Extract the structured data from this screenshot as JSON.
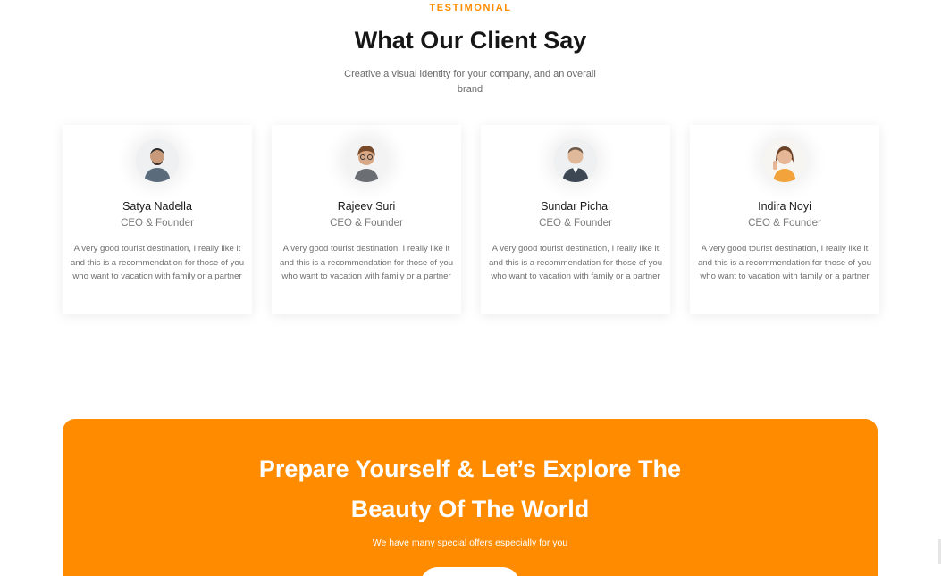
{
  "section": {
    "eyebrow": "TESTIMONIAL",
    "title": "What Our Client Say",
    "subtitle": "Creative a visual identity for your company, and an overall brand"
  },
  "testimonials": [
    {
      "name": "Satya Nadella",
      "role": "CEO & Founder",
      "quote": "A very good tourist destination, I really like it and this is a recommendation for those of you who want to vacation with family or a partner",
      "avatar_icon": "person-avatar-icon"
    },
    {
      "name": "Rajeev Suri",
      "role": "CEO & Founder",
      "quote": "A very good tourist destination, I really like it and this is a recommendation for those of you who want to vacation with family or a partner",
      "avatar_icon": "person-avatar-icon"
    },
    {
      "name": "Sundar Pichai",
      "role": "CEO & Founder",
      "quote": "A very good tourist destination, I really like it and this is a recommendation for those of you who want to vacation with family or a partner",
      "avatar_icon": "person-avatar-icon"
    },
    {
      "name": "Indira Noyi",
      "role": "CEO & Founder",
      "quote": "A very good tourist destination, I really like it and this is a recommendation for those of you who want to vacation with family or a partner",
      "avatar_icon": "person-avatar-icon"
    }
  ],
  "banner": {
    "title_line1": "Prepare Yourself & Let’s Explore The",
    "title_line2": "Beauty Of The World",
    "subtitle": "We have many special offers especially for you"
  },
  "colors": {
    "accent": "#ff8c00",
    "heading": "#161616",
    "muted": "#707070"
  }
}
